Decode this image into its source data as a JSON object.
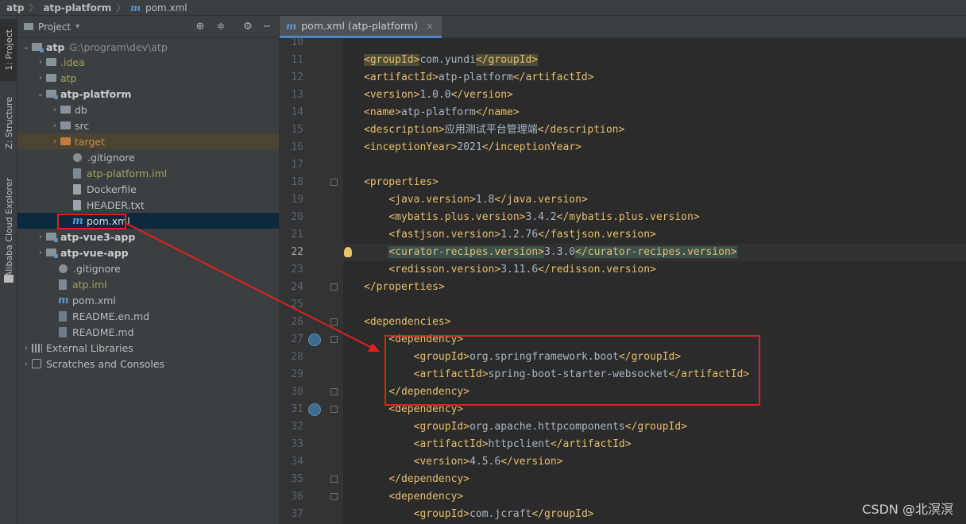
{
  "breadcrumb": {
    "root": "atp",
    "module": "atp-platform",
    "file_icon": "m",
    "file": "pom.xml"
  },
  "toolstrip": {
    "project": "1: Project",
    "structure": "Z: Structure",
    "alibaba": "Alibaba Cloud Explorer"
  },
  "project_panel": {
    "title": "Project",
    "icons": [
      "locate-icon",
      "collapse-icon",
      "gear-icon",
      "minimize-icon"
    ],
    "tree": [
      {
        "label": "atp",
        "path": "G:\\program\\dev\\atp"
      },
      {
        "label": ".idea"
      },
      {
        "label": "atp"
      },
      {
        "label": "atp-platform"
      },
      {
        "label": "db"
      },
      {
        "label": "src"
      },
      {
        "label": "target"
      },
      {
        "label": ".gitignore"
      },
      {
        "label": "atp-platform.iml"
      },
      {
        "label": "Dockerfile"
      },
      {
        "label": "HEADER.txt"
      },
      {
        "label": "pom.xml"
      },
      {
        "label": "atp-vue3-app"
      },
      {
        "label": "atp-vue-app"
      },
      {
        "label": ".gitignore"
      },
      {
        "label": "atp.iml"
      },
      {
        "label": "pom.xml"
      },
      {
        "label": "README.en.md"
      },
      {
        "label": "README.md"
      },
      {
        "label": "External Libraries"
      },
      {
        "label": "Scratches and Consoles"
      }
    ]
  },
  "editor": {
    "tab_icon": "m",
    "tab_label": "pom.xml (atp-platform)",
    "tab_close": "×",
    "current_line": 22,
    "lines": [
      {
        "no": "10",
        "code": ""
      },
      {
        "no": "11",
        "code": "<groupId>com.yundi</groupId>"
      },
      {
        "no": "12",
        "code": "<artifactId>atp-platform</artifactId>"
      },
      {
        "no": "13",
        "code": "<version>1.0.0</version>"
      },
      {
        "no": "14",
        "code": "<name>atp-platform</name>"
      },
      {
        "no": "15",
        "code": "<description>应用测试平台管理端</description>"
      },
      {
        "no": "16",
        "code": "<inceptionYear>2021</inceptionYear>"
      },
      {
        "no": "17",
        "code": ""
      },
      {
        "no": "18",
        "code": "<properties>"
      },
      {
        "no": "19",
        "code": "    <java.version>1.8</java.version>"
      },
      {
        "no": "20",
        "code": "    <mybatis.plus.version>3.4.2</mybatis.plus.version>"
      },
      {
        "no": "21",
        "code": "    <fastjson.version>1.2.76</fastjson.version>"
      },
      {
        "no": "22",
        "code": "    <curator-recipes.version>3.3.0</curator-recipes.version>"
      },
      {
        "no": "23",
        "code": "    <redisson.version>3.11.6</redisson.version>"
      },
      {
        "no": "24",
        "code": "</properties>"
      },
      {
        "no": "25",
        "code": ""
      },
      {
        "no": "26",
        "code": "<dependencies>"
      },
      {
        "no": "27",
        "code": "    <dependency>"
      },
      {
        "no": "28",
        "code": "        <groupId>org.springframework.boot</groupId>"
      },
      {
        "no": "29",
        "code": "        <artifactId>spring-boot-starter-websocket</artifactId>"
      },
      {
        "no": "30",
        "code": "    </dependency>"
      },
      {
        "no": "31",
        "code": "    <dependency>"
      },
      {
        "no": "32",
        "code": "        <groupId>org.apache.httpcomponents</groupId>"
      },
      {
        "no": "33",
        "code": "        <artifactId>httpclient</artifactId>"
      },
      {
        "no": "34",
        "code": "        <version>4.5.6</version>"
      },
      {
        "no": "35",
        "code": "    </dependency>"
      },
      {
        "no": "36",
        "code": "    <dependency>"
      },
      {
        "no": "37",
        "code": "        <groupId>com.jcraft</groupId>"
      }
    ]
  },
  "colors": {
    "tag": "#e8bf6a",
    "text": "#a9b7c6",
    "annotation": "#e41e1e"
  },
  "watermark": "CSDN @北溟溟"
}
